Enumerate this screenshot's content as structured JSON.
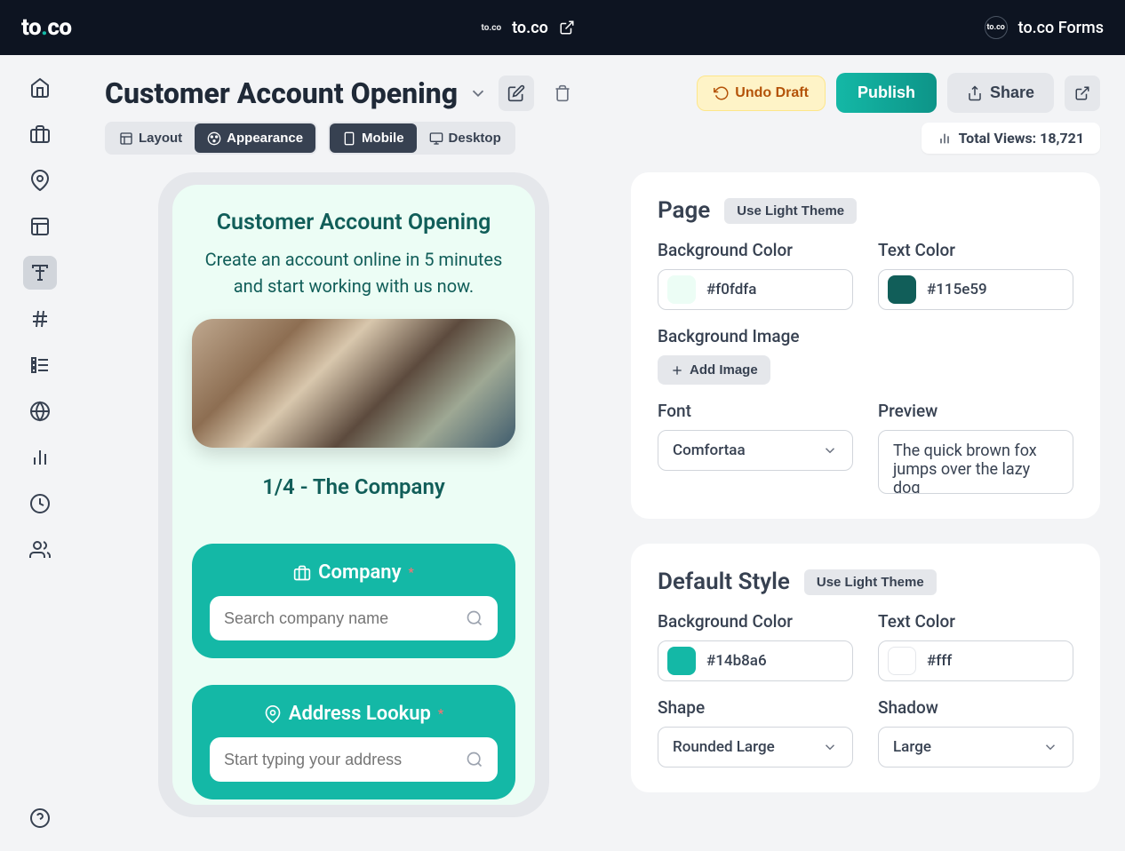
{
  "topbar": {
    "logo_prefix": "to",
    "logo_dot": ".",
    "logo_suffix": "co",
    "center_mini": "to.co",
    "center_label": "to.co",
    "right_label": "to.co Forms"
  },
  "pageHeader": {
    "title": "Customer Account Opening",
    "undo": "Undo Draft",
    "publish": "Publish",
    "share": "Share"
  },
  "toolbar": {
    "layout": "Layout",
    "appearance": "Appearance",
    "mobile": "Mobile",
    "desktop": "Desktop",
    "totalViews": "Total Views: 18,721"
  },
  "preview": {
    "formTitle": "Customer Account Opening",
    "formSub": "Create an account online in 5 minutes and start working with us now.",
    "step": "1/4 - The Company",
    "companyLabel": "Company",
    "companyPlaceholder": "Search company name",
    "addressLabel": "Address Lookup",
    "addressPlaceholder": "Start typing your address"
  },
  "panels": {
    "page": {
      "title": "Page",
      "theme": "Use Light Theme",
      "bgLabel": "Background Color",
      "bgValue": "#f0fdfa",
      "textLabel": "Text Color",
      "textValue": "#115e59",
      "bgImageLabel": "Background Image",
      "addImage": "Add Image",
      "fontLabel": "Font",
      "fontValue": "Comfortaa",
      "previewLabel": "Preview",
      "previewText": "The quick brown fox jumps over the lazy dog"
    },
    "style": {
      "title": "Default Style",
      "theme": "Use Light Theme",
      "bgLabel": "Background Color",
      "bgValue": "#14b8a6",
      "textLabel": "Text Color",
      "textValue": "#fff",
      "shapeLabel": "Shape",
      "shapeValue": "Rounded Large",
      "shadowLabel": "Shadow",
      "shadowValue": "Large"
    }
  }
}
